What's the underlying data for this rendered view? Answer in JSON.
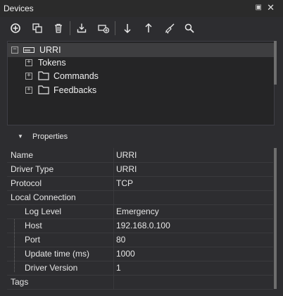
{
  "window": {
    "title": "Devices",
    "pin_icon": "▣",
    "close_icon": "✕"
  },
  "toolbar": {
    "icons": [
      "add-icon",
      "duplicate-icon",
      "delete-icon",
      "import-icon",
      "add-driver-icon",
      "move-down-icon",
      "move-up-icon",
      "clean-icon",
      "search-icon"
    ]
  },
  "tree": {
    "root": {
      "label": "URRI",
      "expander": "−"
    },
    "children": [
      {
        "label": "Tokens",
        "expander": "+"
      },
      {
        "label": "Commands",
        "expander": "+"
      },
      {
        "label": "Feedbacks",
        "expander": "+"
      }
    ]
  },
  "properties": {
    "header": "Properties",
    "rows": [
      {
        "name": "Name",
        "value": "URRI"
      },
      {
        "name": "Driver Type",
        "value": "URRI"
      },
      {
        "name": "Protocol",
        "value": "TCP"
      },
      {
        "name": "Local Connection",
        "value": ""
      },
      {
        "name": "Log Level",
        "value": "Emergency"
      },
      {
        "name": "Host",
        "value": "192.168.0.100"
      },
      {
        "name": "Port",
        "value": "80"
      },
      {
        "name": "Update time (ms)",
        "value": "1000"
      },
      {
        "name": "Driver Version",
        "value": "1"
      },
      {
        "name": "Tags",
        "value": ""
      }
    ]
  }
}
